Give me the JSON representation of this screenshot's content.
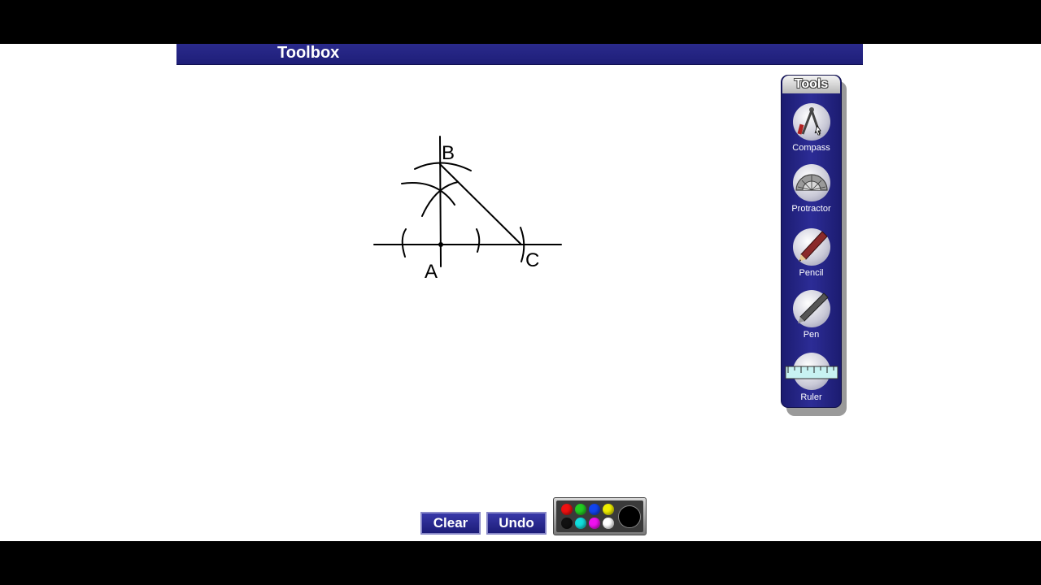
{
  "app": {
    "title": "Toolbox"
  },
  "tools": {
    "header": "Tools",
    "items": [
      {
        "label": "Compass",
        "icon": "compass-icon"
      },
      {
        "label": "Protractor",
        "icon": "protractor-icon"
      },
      {
        "label": "Pencil",
        "icon": "pencil-icon"
      },
      {
        "label": "Pen",
        "icon": "pen-icon"
      },
      {
        "label": "Ruler",
        "icon": "ruler-icon"
      }
    ]
  },
  "controls": {
    "clear_label": "Clear",
    "undo_label": "Undo"
  },
  "drawing": {
    "point_labels": [
      "A",
      "B",
      "C"
    ]
  },
  "palette": {
    "colors": [
      "#ee1111",
      "#22cc22",
      "#1144ee",
      "#eeee00",
      "#111111",
      "#11dddd",
      "#ee11ee",
      "#ffffff"
    ],
    "selected": "#000000"
  },
  "colors": {
    "accent": "#1e1e78",
    "background": "#ffffff"
  }
}
